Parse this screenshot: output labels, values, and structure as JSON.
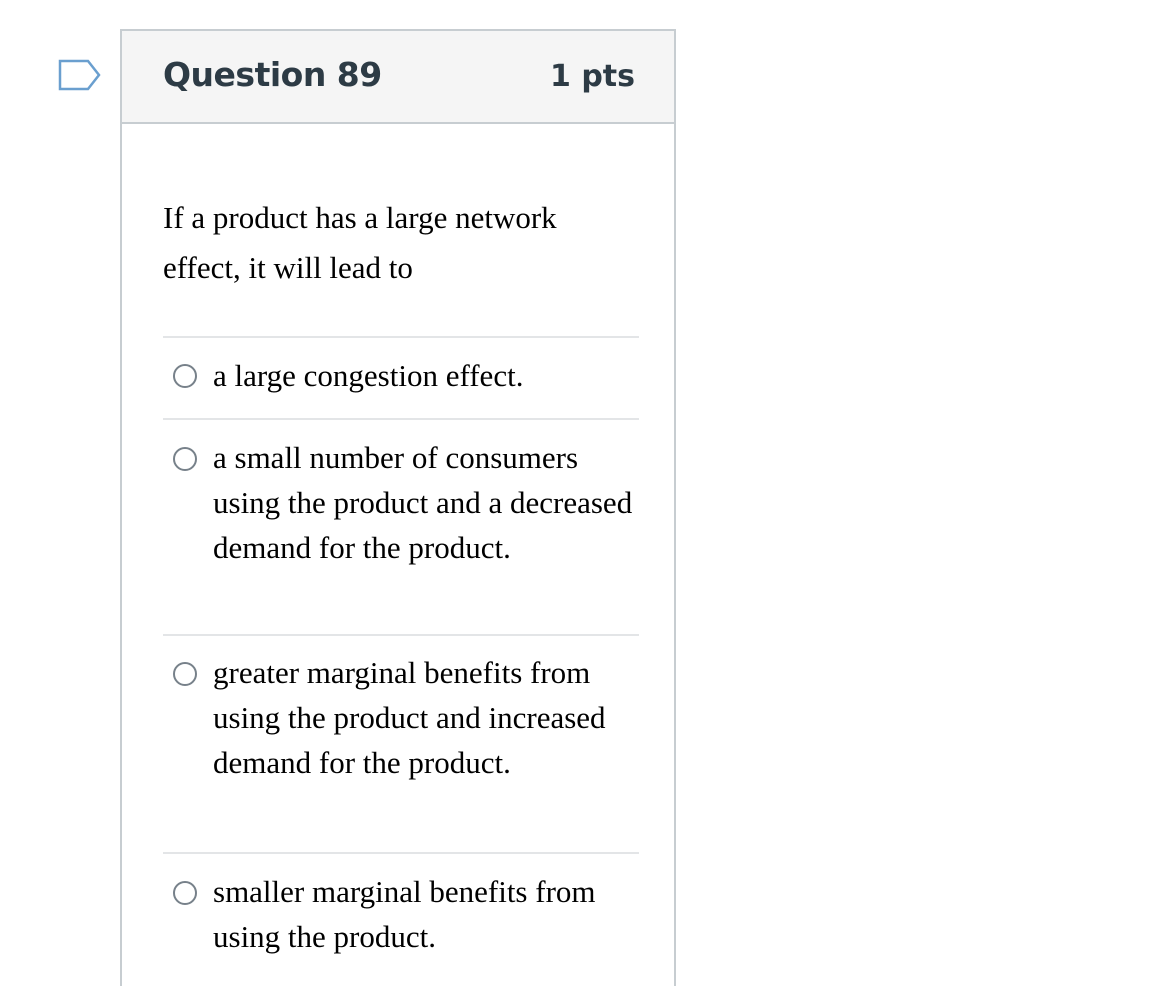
{
  "question": {
    "title": "Question 89",
    "points": "1 pts",
    "text": "If a product has a large network effect, it will lead to",
    "flag_icon": "flag-outline-icon"
  },
  "answers": [
    {
      "label": "a large congestion effect.",
      "selected": false
    },
    {
      "label": "a small number of consumers using the product and a decreased demand for the product.",
      "selected": false
    },
    {
      "label": "greater marginal benefits from using the product and increased demand for the product.",
      "selected": false
    },
    {
      "label": "smaller marginal benefits from using the product.",
      "selected": false
    }
  ],
  "colors": {
    "header_bg": "#f5f5f5",
    "border": "#c7cdd1",
    "title_text": "#2d3b45",
    "flag_stroke": "#6a9fcf",
    "divider": "#e3e5e7",
    "radio_border": "#77818a"
  }
}
